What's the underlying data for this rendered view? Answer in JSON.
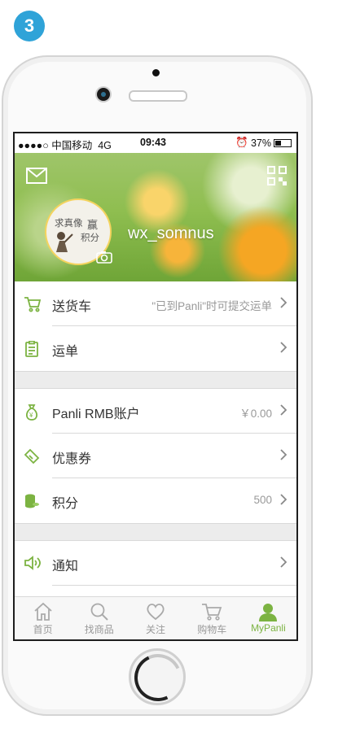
{
  "step_badge": "3",
  "status_bar": {
    "carrier": "●●●●○ 中国移动",
    "network": "4G",
    "time": "09:43",
    "battery": "37%"
  },
  "profile": {
    "avatar_text_1": "求真像",
    "avatar_text_2": "赢",
    "avatar_text_3": "积分",
    "username": "wx_somnus"
  },
  "menu": {
    "cart": {
      "label": "送货车",
      "value": "\"已到Panli\"时可提交运单"
    },
    "waybill": {
      "label": "运单"
    },
    "rmb_account": {
      "label": "Panli RMB账户",
      "value": "￥0.00"
    },
    "coupons": {
      "label": "优惠券"
    },
    "points": {
      "label": "积分",
      "value": "500"
    },
    "notify": {
      "label": "通知"
    }
  },
  "tabbar": {
    "home": "首页",
    "search": "找商品",
    "follow": "关注",
    "cart": "购物车",
    "mypanli": "MyPanli"
  },
  "colors": {
    "accent": "#7cb342",
    "badge": "#2fa3d8"
  }
}
